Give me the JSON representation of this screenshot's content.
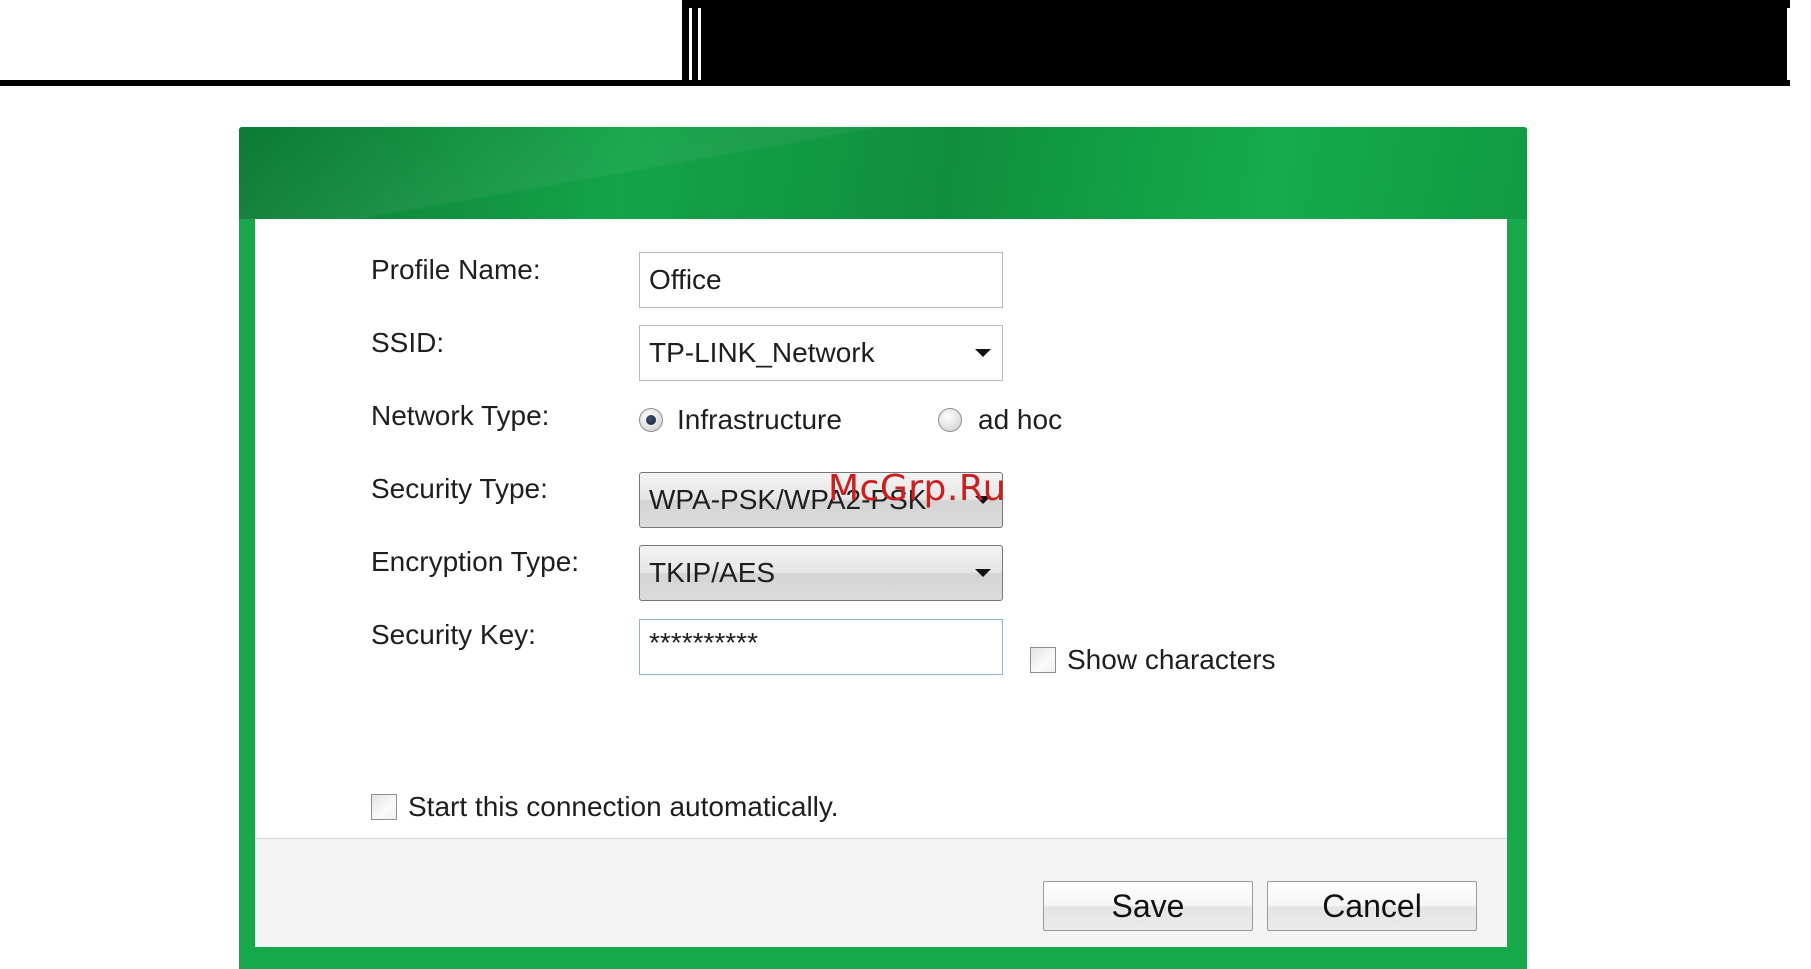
{
  "dialog": {
    "profile_name": {
      "label": "Profile Name:",
      "value": "Office"
    },
    "ssid": {
      "label": "SSID:",
      "value": "TP-LINK_Network"
    },
    "network_type": {
      "label": "Network Type:",
      "options": [
        {
          "label": "Infrastructure",
          "selected": true
        },
        {
          "label": "ad hoc",
          "selected": false
        }
      ]
    },
    "security_type": {
      "label": "Security Type:",
      "value": "WPA-PSK/WPA2-PSK"
    },
    "encryption_type": {
      "label": "Encryption Type:",
      "value": "TKIP/AES"
    },
    "security_key": {
      "label": "Security Key:",
      "value": "**********"
    },
    "show_characters": {
      "label": "Show characters",
      "checked": false
    },
    "auto_connect": {
      "label": "Start this connection automatically.",
      "checked": false
    },
    "buttons": {
      "save": "Save",
      "cancel": "Cancel"
    }
  },
  "watermark": "McGrp.Ru",
  "colors": {
    "window_frame": "#16a84a",
    "body_background": "#ffffff",
    "footer_background": "#f4f4f4",
    "watermark": "#cc1f1f"
  },
  "icons": {
    "dropdown_arrow": "chevron-down-icon",
    "radio_checked": "radio-checked-icon",
    "radio_unchecked": "radio-unchecked-icon",
    "checkbox_unchecked": "checkbox-unchecked-icon"
  }
}
